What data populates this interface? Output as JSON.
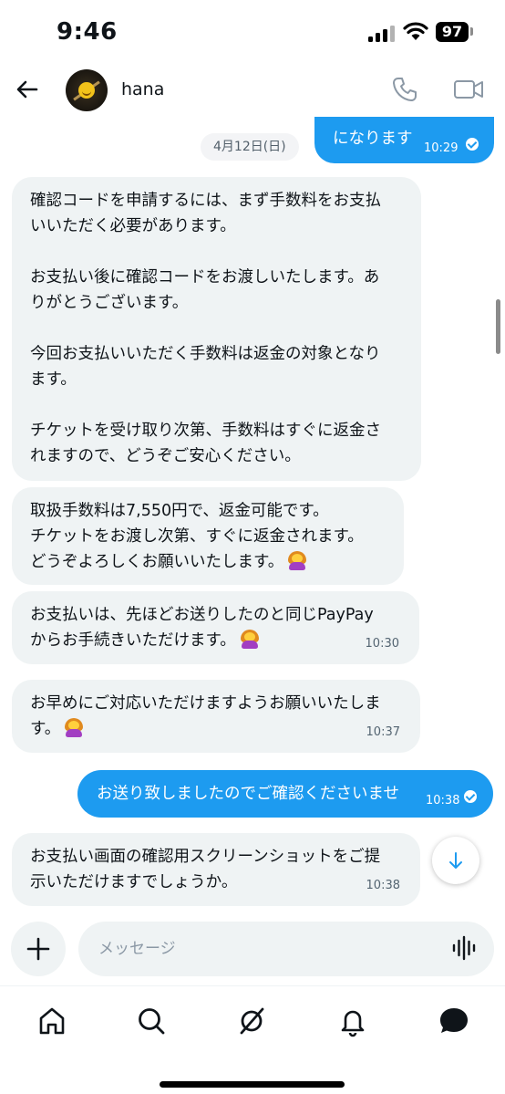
{
  "status_bar": {
    "time": "9:46",
    "battery": "97"
  },
  "header": {
    "contact_name": "hana"
  },
  "chat": {
    "date_divider": "4月12日(日)",
    "messages": [
      {
        "dir": "out",
        "text": "になります",
        "time": "10:29"
      },
      {
        "dir": "in",
        "text": "確認コードを申請するには、まず手数料をお支払\nいいただく必要があります。\n\nお支払い後に確認コードをお渡しいたします。あ\nりがとうございます。\n\n今回お支払いいただく手数料は返金の対象となり\nます。\n\nチケットを受け取り次第、手数料はすぐに返金さ\nれますので、どうぞご安心ください。",
        "time": ""
      },
      {
        "dir": "in",
        "text": "取扱手数料は7,550円で、返金可能です。\nチケットをお渡し次第、すぐに返金されます。\nどうぞよろしくお願いいたします。",
        "time": ""
      },
      {
        "dir": "in",
        "text": "お支払いは、先ほどお送りしたのと同じPayPay\nからお手続きいただけます。",
        "time": "10:30"
      },
      {
        "dir": "in",
        "text": "お早めにご対応いただけますようお願いいたしま\nす。",
        "time": "10:37"
      },
      {
        "dir": "out",
        "text": "お送り致しましたのでご確認くださいませ",
        "time": "10:38"
      },
      {
        "dir": "in",
        "text": "お支払い画面の確認用スクリーンショットをご提\n示いただけますでしょうか。",
        "time": "10:38"
      }
    ]
  },
  "composer": {
    "placeholder": "メッセージ"
  },
  "colors": {
    "accent": "#1d9bf0",
    "incoming_bubble": "#eff3f4",
    "text": "#0f1419"
  },
  "icons": [
    "back-arrow-icon",
    "phone-icon",
    "video-camera-icon",
    "arrow-down-icon",
    "plus-icon",
    "voice-wave-icon",
    "home-icon",
    "search-icon",
    "grok-icon",
    "bell-icon",
    "messages-icon"
  ]
}
